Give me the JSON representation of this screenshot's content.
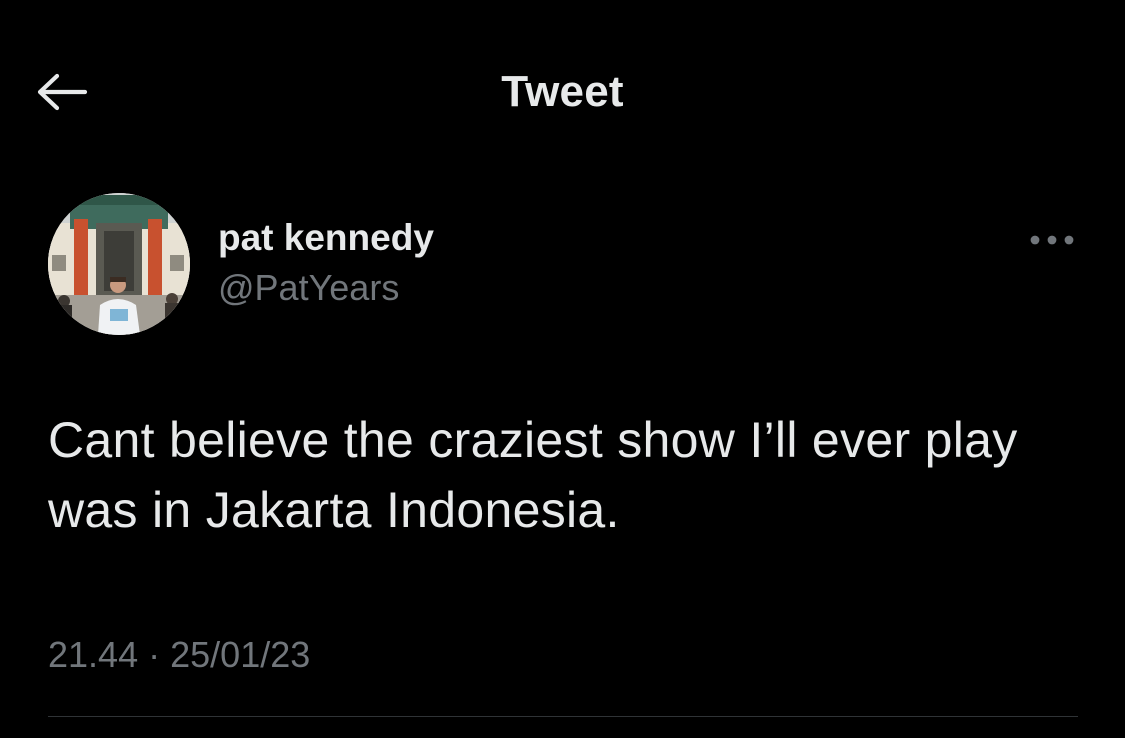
{
  "header": {
    "title": "Tweet",
    "back_icon": "arrow-left-icon"
  },
  "tweet": {
    "author": {
      "display_name": "pat kennedy",
      "handle": "@PatYears",
      "avatar_icon": "profile-photo"
    },
    "more_icon": "more-dots-icon",
    "text": "Cant believe the craziest show I’ll ever play was in Jakarta Indonesia.",
    "time": "21.44",
    "separator": "·",
    "date": "25/01/23"
  },
  "colors": {
    "background": "#000000",
    "primary_text": "#e7e9ea",
    "secondary_text": "#71767b",
    "divider": "#2f3336"
  }
}
